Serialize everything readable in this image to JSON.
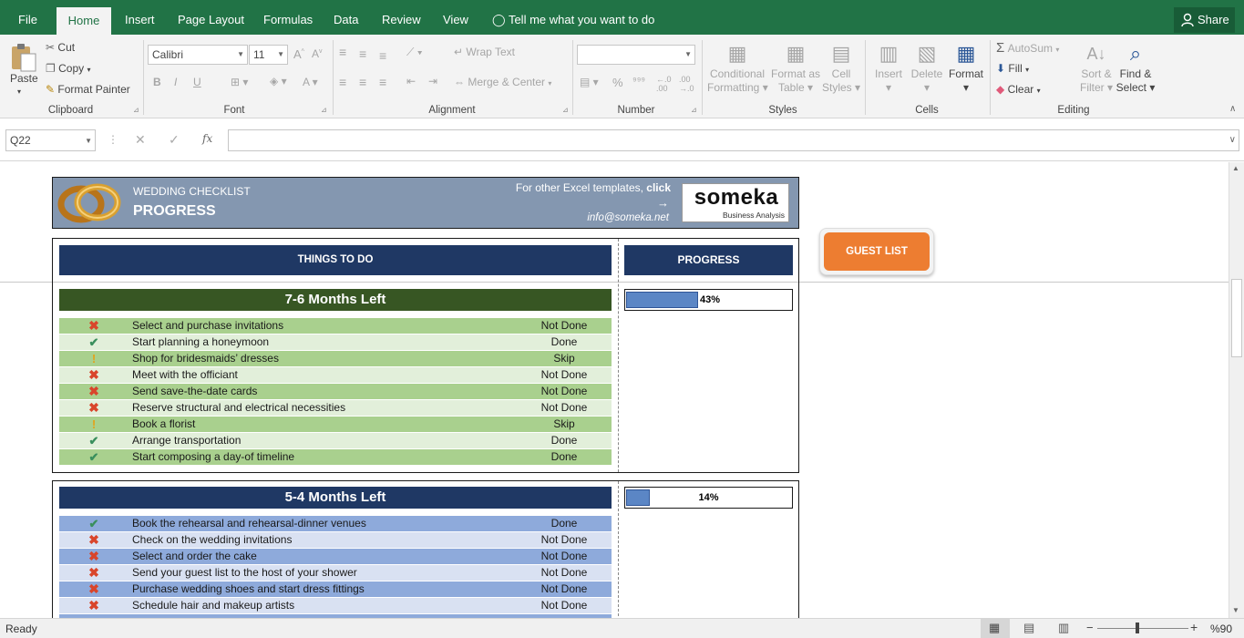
{
  "tabs": [
    "File",
    "Home",
    "Insert",
    "Page Layout",
    "Formulas",
    "Data",
    "Review",
    "View"
  ],
  "tell_me": "Tell me what you want to do",
  "share": "Share",
  "clipboard": {
    "paste": "Paste",
    "cut": "Cut",
    "copy": "Copy",
    "format_painter": "Format Painter",
    "label": "Clipboard"
  },
  "font": {
    "name": "Calibri",
    "size": "11",
    "label": "Font"
  },
  "alignment": {
    "wrap_text": "Wrap Text",
    "merge_center": "Merge & Center",
    "label": "Alignment"
  },
  "number": {
    "format": "",
    "label": "Number"
  },
  "styles": {
    "conditional": "Conditional",
    "conditional2": "Formatting",
    "format_as": "Format as",
    "format_as2": "Table",
    "cell": "Cell",
    "cell2": "Styles",
    "label": "Styles"
  },
  "cells": {
    "insert": "Insert",
    "delete": "Delete",
    "format": "Format",
    "label": "Cells"
  },
  "editing": {
    "autosum": "AutoSum",
    "fill": "Fill",
    "clear": "Clear",
    "sort": "Sort &",
    "sort2": "Filter",
    "find": "Find &",
    "find2": "Select",
    "label": "Editing"
  },
  "formula_bar": {
    "name_box": "Q22",
    "fx": "fx",
    "formula": ""
  },
  "header": {
    "title": "WEDDING CHECKLIST",
    "subtitle": "PROGRESS",
    "templates_text": "For other Excel templates,",
    "click": "click",
    "arrow": "→",
    "email": "info@someka.net",
    "logo": "someka",
    "logo_sub": "Business Analysis"
  },
  "columns": {
    "todo": "THINGS TO DO",
    "progress": "PROGRESS"
  },
  "guest_list": "GUEST LIST",
  "sections": [
    {
      "title": "7-6 Months Left",
      "progress": 0.43,
      "progress_label": "43%",
      "items": [
        {
          "icon": "cross",
          "task": "Select and purchase invitations",
          "status": "Not Done"
        },
        {
          "icon": "check",
          "task": "Start planning a honeymoon",
          "status": "Done"
        },
        {
          "icon": "warn",
          "task": "Shop for bridesmaids’ dresses",
          "status": "Skip"
        },
        {
          "icon": "cross",
          "task": "Meet with the officiant",
          "status": "Not Done"
        },
        {
          "icon": "cross",
          "task": "Send save-the-date cards",
          "status": "Not Done"
        },
        {
          "icon": "cross",
          "task": "Reserve structural and electrical necessities",
          "status": "Not Done"
        },
        {
          "icon": "warn",
          "task": "Book a florist",
          "status": "Skip"
        },
        {
          "icon": "check",
          "task": "Arrange transportation",
          "status": "Done"
        },
        {
          "icon": "check",
          "task": "Start composing a day-of timeline",
          "status": "Done"
        }
      ]
    },
    {
      "title": "5-4 Months Left",
      "progress": 0.14,
      "progress_label": "14%",
      "items": [
        {
          "icon": "check",
          "task": "Book the rehearsal and rehearsal-dinner venues",
          "status": "Done"
        },
        {
          "icon": "cross",
          "task": "Check on the wedding invitations",
          "status": "Not Done"
        },
        {
          "icon": "cross",
          "task": "Select and order the cake",
          "status": "Not Done"
        },
        {
          "icon": "cross",
          "task": "Send your guest list to the host of your shower",
          "status": "Not Done"
        },
        {
          "icon": "cross",
          "task": "Purchase wedding shoes and start dress fittings",
          "status": "Not Done"
        },
        {
          "icon": "cross",
          "task": "Schedule hair and makeup artists",
          "status": "Not Done"
        }
      ]
    }
  ],
  "status_bar": {
    "ready": "Ready",
    "zoom": "%90"
  },
  "colors": {
    "excel_green": "#217346",
    "navy": "#1f3864",
    "dark_green": "#375623",
    "orange": "#ed7d31"
  }
}
